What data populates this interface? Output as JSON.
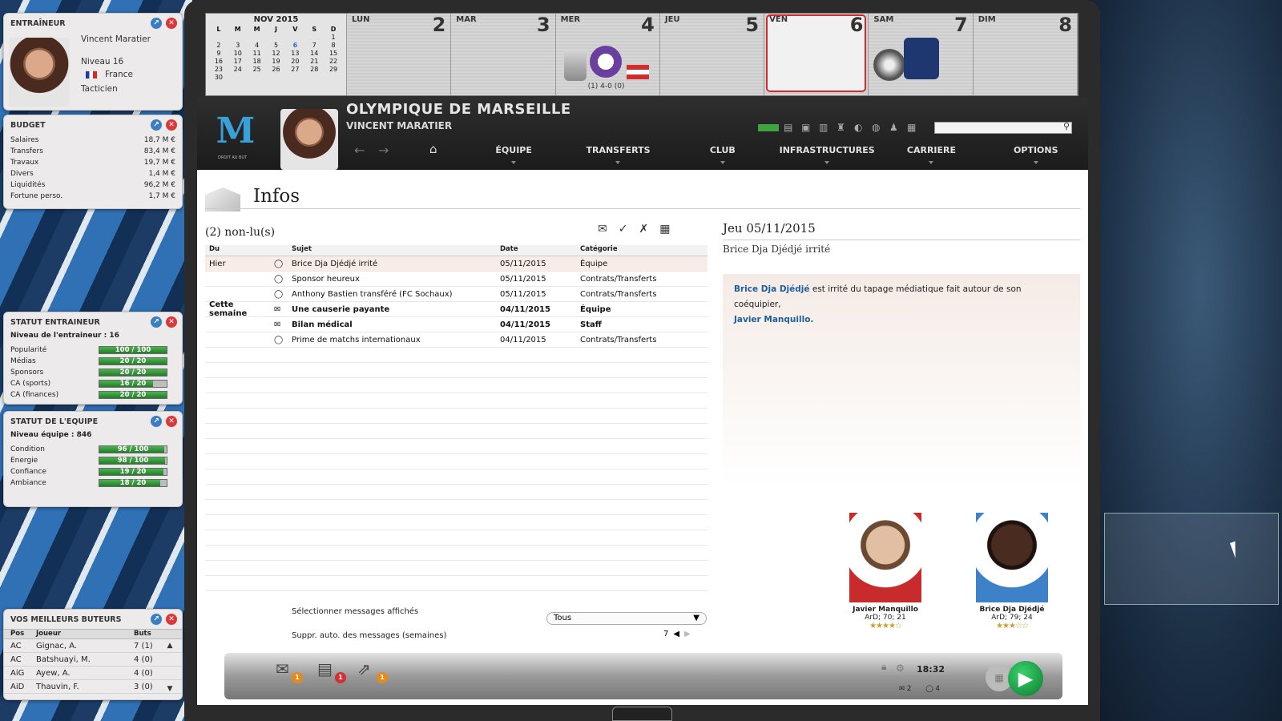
{
  "coach": {
    "title": "ENTRAÎNEUR",
    "name": "Vincent Maratier",
    "level": "Niveau 16",
    "country": "France",
    "style": "Tacticien"
  },
  "budget": {
    "title": "BUDGET",
    "rows": [
      {
        "label": "Salaires",
        "value": "18,7 M €"
      },
      {
        "label": "Transfers",
        "value": "83,4 M €"
      },
      {
        "label": "Travaux",
        "value": "19,7 M €"
      },
      {
        "label": "Divers",
        "value": "1,4 M €"
      },
      {
        "label": "Liquidités",
        "value": "96,2 M €"
      },
      {
        "label": "Fortune perso.",
        "value": "1,7 M €"
      }
    ]
  },
  "coach_status": {
    "title": "STATUT ENTRAINEUR",
    "level": "Niveau de l'entraineur : 16",
    "rows": [
      {
        "label": "Popularité",
        "text": "100 / 100",
        "fill": 1.0
      },
      {
        "label": "Médias",
        "text": "20 / 20",
        "fill": 1.0
      },
      {
        "label": "Sponsors",
        "text": "20 / 20",
        "fill": 1.0
      },
      {
        "label": "CA (sports)",
        "text": "16 / 20",
        "fill": 0.8
      },
      {
        "label": "CA (finances)",
        "text": "20 / 20",
        "fill": 1.0
      }
    ]
  },
  "team_status": {
    "title": "STATUT DE L'EQUIPE",
    "level": "Niveau équipe : 846",
    "rows": [
      {
        "label": "Condition",
        "text": "96 / 100",
        "fill": 0.96
      },
      {
        "label": "Energie",
        "text": "98 / 100",
        "fill": 0.98
      },
      {
        "label": "Confiance",
        "text": "19 / 20",
        "fill": 0.95
      },
      {
        "label": "Ambiance",
        "text": "18 / 20",
        "fill": 0.9
      }
    ]
  },
  "scorers": {
    "title": "VOS MEILLEURS BUTEURS",
    "headers": {
      "pos": "Pos",
      "player": "Joueur",
      "goals": "Buts"
    },
    "rows": [
      {
        "pos": "AC",
        "player": "Gignac, A.",
        "goals": "7 (1)"
      },
      {
        "pos": "AC",
        "player": "Batshuayi, M.",
        "goals": "4 (0)"
      },
      {
        "pos": "AiG",
        "player": "Ayew, A.",
        "goals": "4 (0)"
      },
      {
        "pos": "AiD",
        "player": "Thauvin, F.",
        "goals": "3 (0)"
      }
    ]
  },
  "calendar": {
    "month": "NOV 2015",
    "weekdays": [
      "L",
      "M",
      "M",
      "J",
      "V",
      "S",
      "D"
    ],
    "weeks": [
      [
        "",
        "",
        "",
        "",
        "",
        "",
        "1"
      ],
      [
        "2",
        "3",
        "4",
        "5",
        "6",
        "7",
        "8"
      ],
      [
        "9",
        "10",
        "11",
        "12",
        "13",
        "14",
        "15"
      ],
      [
        "16",
        "17",
        "18",
        "19",
        "20",
        "21",
        "22"
      ],
      [
        "23",
        "24",
        "25",
        "26",
        "27",
        "28",
        "29"
      ],
      [
        "30",
        "",
        "",
        "",
        "",
        "",
        ""
      ]
    ],
    "today": "6",
    "days": [
      {
        "name": "LUN",
        "num": "2"
      },
      {
        "name": "MAR",
        "num": "3"
      },
      {
        "name": "MER",
        "num": "4",
        "score": "(1) 4-0 (0)"
      },
      {
        "name": "JEU",
        "num": "5"
      },
      {
        "name": "VEN",
        "num": "6"
      },
      {
        "name": "SAM",
        "num": "7"
      },
      {
        "name": "DIM",
        "num": "8"
      }
    ]
  },
  "header": {
    "club": "OLYMPIQUE DE MARSEILLE",
    "manager": "VINCENT MARATIER",
    "logo_text": "DROIT AU BUT",
    "menu": [
      "ÉQUIPE",
      "TRANSFERTS",
      "CLUB",
      "INFRASTRUCTURES",
      "CARRIERE",
      "OPTIONS"
    ],
    "search_placeholder": ""
  },
  "inbox": {
    "title": "Infos",
    "unread": "(2) non-lu(s)",
    "headers": {
      "from": "Du",
      "subject": "Sujet",
      "date": "Date",
      "category": "Catégorie"
    },
    "rows": [
      {
        "group": "Hier",
        "subject": "Brice Dja Djédjé irrité",
        "date": "05/11/2015",
        "category": "Équipe",
        "read": true,
        "selected": true
      },
      {
        "group": "",
        "subject": "Sponsor heureux",
        "date": "05/11/2015",
        "category": "Contrats/Transferts",
        "read": true
      },
      {
        "group": "",
        "subject": "Anthony Bastien transféré (FC Sochaux)",
        "date": "05/11/2015",
        "category": "Contrats/Transferts",
        "read": true
      },
      {
        "group": "Cette semaine",
        "subject": "Une causerie payante",
        "date": "04/11/2015",
        "category": "Équipe",
        "read": false
      },
      {
        "group": "",
        "subject": "Bilan médical",
        "date": "04/11/2015",
        "category": "Staff",
        "read": false
      },
      {
        "group": "",
        "subject": "Prime de matchs internationaux",
        "date": "04/11/2015",
        "category": "Contrats/Transferts",
        "read": true
      }
    ],
    "filter_label": "Sélectionner messages affichés",
    "filter_value": "Tous",
    "autodelete_label": "Suppr. auto. des messages (semaines)",
    "autodelete_value": "7"
  },
  "detail": {
    "date": "Jeu 05/11/2015",
    "subject": "Brice Dja Djédjé irrité",
    "name1": "Brice Dja Djédjé",
    "text1": " est irrité du tapage médiatique fait autour de son coéquipier,",
    "name2": "Javier Manquillo.",
    "players": [
      {
        "name": "Javier Manquillo",
        "info": "ArD; 70; 21",
        "stars": "★★★★☆"
      },
      {
        "name": "Brice Dja Djédjé",
        "info": "ArD; 79; 24",
        "stars": "★★★☆☆"
      }
    ]
  },
  "bottom": {
    "badges": [
      "1",
      "1",
      "1"
    ],
    "time": "18:32",
    "mail_count": "2",
    "msg_count": "4"
  }
}
